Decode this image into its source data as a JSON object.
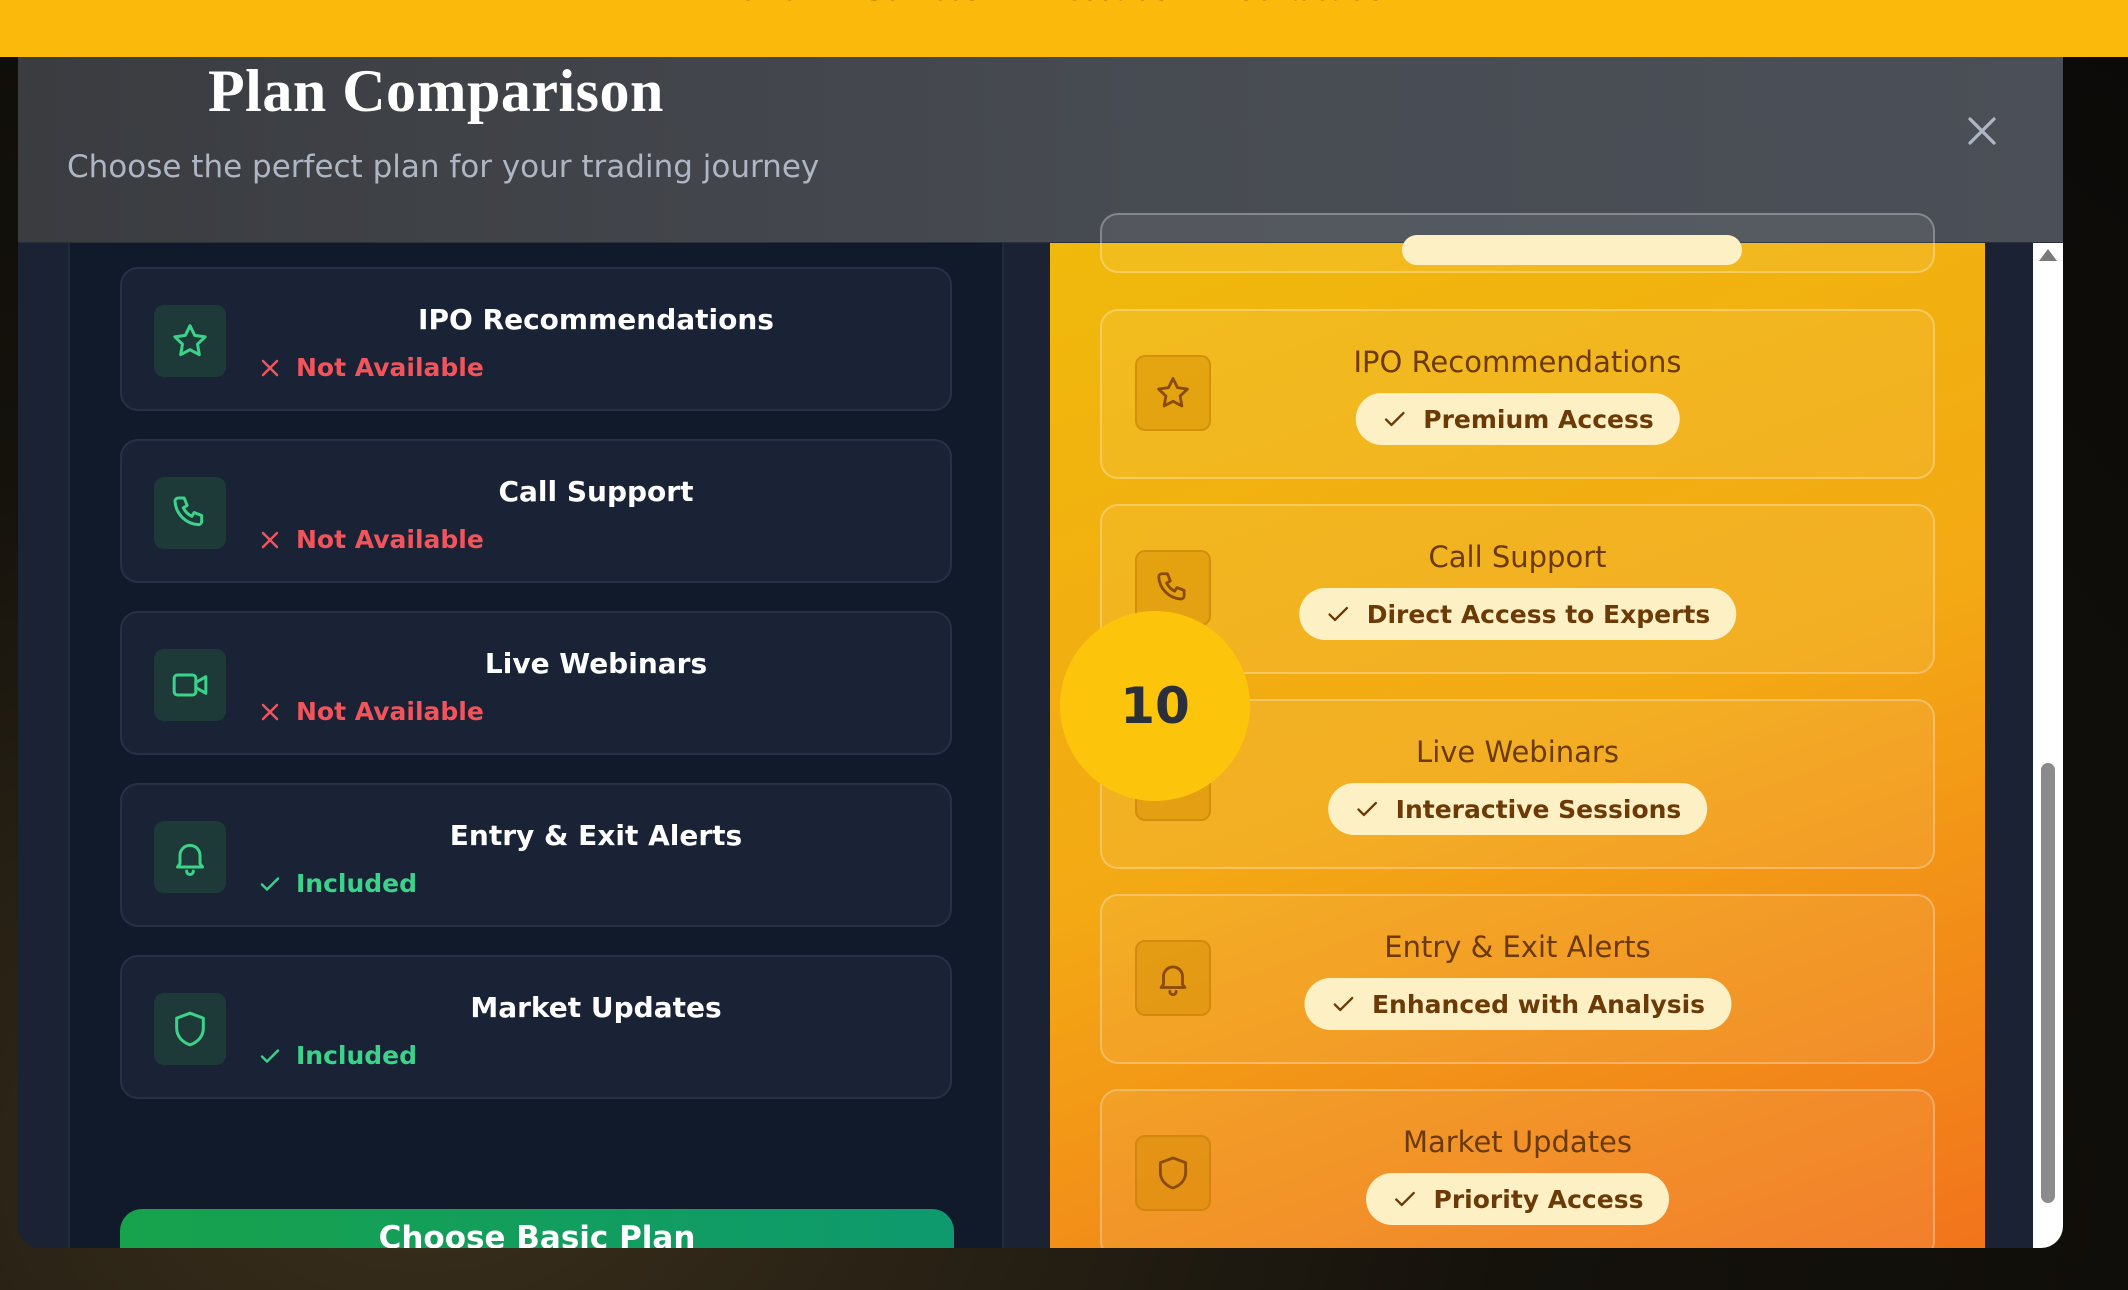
{
  "nav": {
    "items": [
      {
        "label": "Home"
      },
      {
        "label": "Services"
      },
      {
        "label": "About Us"
      },
      {
        "label": "Contact Us"
      }
    ]
  },
  "modal": {
    "title": "Plan Comparison",
    "subtitle": "Choose the perfect plan for your trading journey"
  },
  "basic": {
    "features": [
      {
        "name": "IPO Recommendations",
        "status": "Not Available",
        "included": false,
        "icon": "star-icon"
      },
      {
        "name": "Call Support",
        "status": "Not Available",
        "included": false,
        "icon": "phone-icon"
      },
      {
        "name": "Live Webinars",
        "status": "Not Available",
        "included": false,
        "icon": "video-icon"
      },
      {
        "name": "Entry & Exit Alerts",
        "status": "Included",
        "included": true,
        "icon": "bell-icon"
      },
      {
        "name": "Market Updates",
        "status": "Included",
        "included": true,
        "icon": "shield-icon"
      }
    ],
    "cta_label": "Choose Basic Plan"
  },
  "premium": {
    "features": [
      {
        "name": "IPO Recommendations",
        "badge": "Premium Access",
        "icon": "star-icon"
      },
      {
        "name": "Call Support",
        "badge": "Direct Access to Experts",
        "icon": "phone-icon"
      },
      {
        "name": "Live Webinars",
        "badge": "Interactive Sessions",
        "icon": "video-icon"
      },
      {
        "name": "Entry & Exit Alerts",
        "badge": "Enhanced with Analysis",
        "icon": "bell-icon"
      },
      {
        "name": "Market Updates",
        "badge": "Priority Access",
        "icon": "shield-icon"
      }
    ]
  },
  "overlay": {
    "step_number": "10"
  },
  "colors": {
    "nav_bg": "#fbb90c",
    "not_available": "#f2545b",
    "included": "#3bd28a",
    "premium_text": "#6b3a06",
    "cta_green": "#17a24c"
  }
}
